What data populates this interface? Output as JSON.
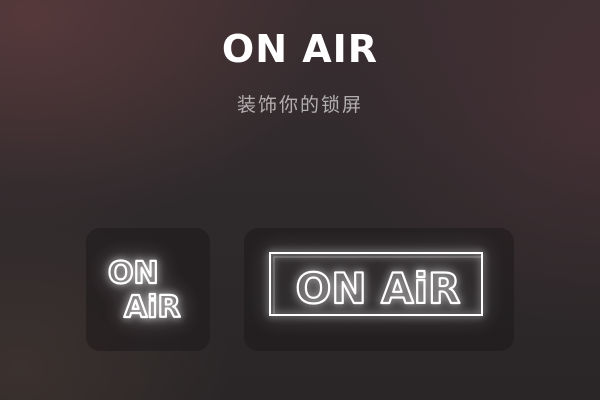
{
  "header": {
    "title": "ON AIR",
    "subtitle": "装饰你的锁屏"
  },
  "widgets": {
    "small": {
      "line1": "ON",
      "line2": "AiR"
    },
    "large": {
      "text": "ON AiR"
    }
  },
  "colors": {
    "neon": "#ffffff",
    "widget_background": "#1e191b"
  }
}
